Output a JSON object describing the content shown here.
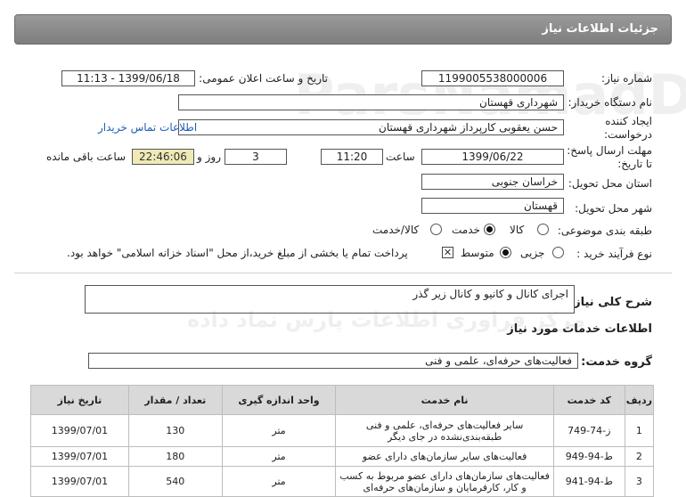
{
  "header": {
    "title": "جزئیات اطلاعات نیاز"
  },
  "need_number": {
    "label": "شماره نیاز:",
    "value": "1199005538000006"
  },
  "announce": {
    "label": "تاریخ و ساعت اعلان عمومی:",
    "value": "1399/06/18 - 11:13"
  },
  "buyer": {
    "label": "نام دستگاه خریدار:",
    "value": "شهرداری قهستان"
  },
  "creator": {
    "label_line1": "ایجاد کننده",
    "label_line2": "درخواست:",
    "value": "حسن یعقوبی کارپرداز شهرداری قهستان",
    "contact_link": "اطلاعات تماس خریدار"
  },
  "deadline": {
    "label_line1": "مهلت ارسال پاسخ:",
    "label_line2": "تا تاریخ:",
    "date": "1399/06/22",
    "time_label": "ساعت",
    "time": "11:20",
    "days": "3",
    "days_label": "روز و",
    "remaining": "22:46:06",
    "remaining_label": "ساعت باقی مانده"
  },
  "province": {
    "label": "استان محل تحویل:",
    "value": "خراسان جنوبی"
  },
  "city": {
    "label": "شهر محل تحویل:",
    "value": "قهستان"
  },
  "category": {
    "label": "طبقه بندی موضوعی:",
    "options": [
      "کالا",
      "خدمت",
      "کالا/خدمت"
    ],
    "selected": "خدمت"
  },
  "process": {
    "label": "نوع فرآیند خرید :",
    "options": [
      "جزیی",
      "متوسط"
    ],
    "selected": "متوسط",
    "payment_note": "پرداخت تمام یا بخشی از مبلغ خرید،از محل \"اسناد خزانه اسلامی\" خواهد بود."
  },
  "description": {
    "label": "شرح کلی نیاز:",
    "value": "اجرای کانال و کانیو و کانال زیر گذر"
  },
  "services_info": {
    "title": "اطلاعات خدمات مورد نیاز"
  },
  "service_group": {
    "label": "گروه خدمت:",
    "value": "فعالیت‌های حرفه‌ای، علمی و فنی"
  },
  "table": {
    "headers": [
      "ردیف",
      "کد خدمت",
      "نام خدمت",
      "واحد اندازه گیری",
      "تعداد / مقدار",
      "تاریخ نیاز"
    ],
    "rows": [
      [
        "1",
        "ز-74-749",
        "سایر فعالیت‌های حرفه‌ای، علمی و فنی طبقه‌بندی‌نشده در جای دیگر",
        "متر",
        "130",
        "1399/07/01"
      ],
      [
        "2",
        "ط-94-949",
        "فعالیت‌های سایر سازمان‌های دارای عضو",
        "متر",
        "180",
        "1399/07/01"
      ],
      [
        "3",
        "ط-94-941",
        "فعالیت‌های سازمان‌های دارای عضو مربوط به کسب و کار، کارفرمایان و سازمان‌های حرفه‌ای",
        "متر",
        "540",
        "1399/07/01"
      ]
    ]
  }
}
